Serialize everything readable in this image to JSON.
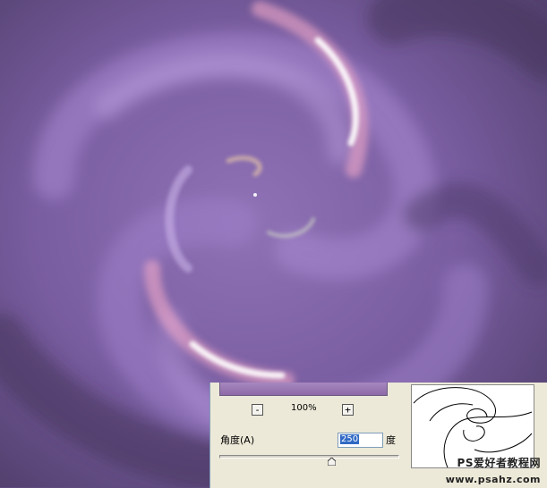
{
  "colors": {
    "background_base": "#5e4a7e",
    "swirl_light": "#a98bd0",
    "highlight_pink": "#f6cde0",
    "dialog_bg": "#ece9d8",
    "selection_blue": "#316ac5"
  },
  "filter_dialog": {
    "zoom": {
      "minus_label": "-",
      "value": "100%",
      "plus_label": "+"
    },
    "angle": {
      "label": "角度(A)",
      "value": "250",
      "unit": "度",
      "slider_value": 250,
      "slider_min": -999,
      "slider_max": 999
    }
  },
  "watermark": {
    "line1": "PS爱好者教程网",
    "line2": "www.psahz.com"
  }
}
